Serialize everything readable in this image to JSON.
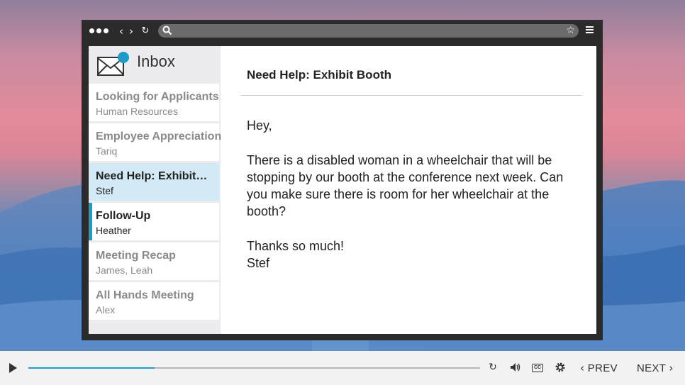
{
  "inbox": {
    "title": "Inbox",
    "items": [
      {
        "subject": "Looking for Applicants",
        "sender": "Human Resources",
        "state": "read"
      },
      {
        "subject": "Employee Appreciation",
        "sender": "Tariq",
        "state": "read"
      },
      {
        "subject": "Need Help: Exhibit…",
        "sender": "Stef",
        "state": "selected"
      },
      {
        "subject": "Follow-Up",
        "sender": "Heather",
        "state": "unread"
      },
      {
        "subject": "Meeting Recap",
        "sender": "James, Leah",
        "state": "read"
      },
      {
        "subject": "All Hands Meeting",
        "sender": "Alex",
        "state": "read"
      }
    ]
  },
  "message": {
    "subject": "Need Help: Exhibit Booth",
    "greeting": "Hey,",
    "body": "There is a disabled woman in a wheelchair that will be stopping by our booth at the conference next week. Can you make sure there is room for her wheelchair at the booth?",
    "closing": "Thanks so much!",
    "signature": "Stef"
  },
  "player": {
    "progress_fraction": 0.28,
    "prev_label": "PREV",
    "next_label": "NEXT"
  },
  "colors": {
    "accent": "#1e9bc6",
    "selected_item": "#d2eaf5",
    "browser_frame": "#2b2b2b"
  },
  "icons": {
    "browser": [
      "window-dots-icon",
      "back-icon",
      "forward-icon",
      "reload-icon",
      "search-icon",
      "star-icon",
      "menu-icon"
    ],
    "player": [
      "play-icon",
      "replay-icon",
      "volume-icon",
      "closed-captions-icon",
      "settings-icon"
    ]
  }
}
